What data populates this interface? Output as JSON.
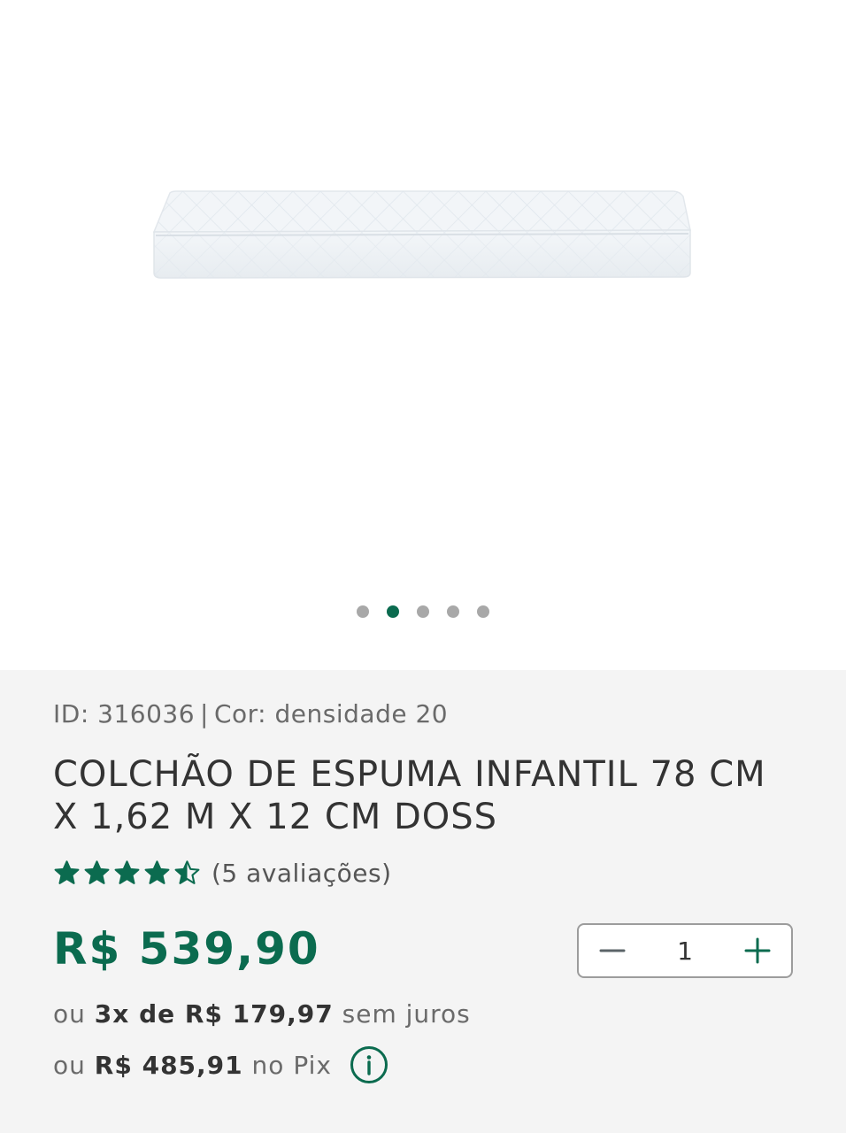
{
  "gallery": {
    "slide_count": 5,
    "active_index": 1,
    "image_icon": "mattress-image"
  },
  "product": {
    "id_label": "ID: 316036",
    "separator": "|",
    "color_label": "Cor: densidade 20",
    "title": "COLCHÃO DE ESPUMA INFANTIL 78 CM X 1,62 M X 12 CM DOSS",
    "rating_value": 4.5,
    "rating_max": 5,
    "rating_count_label": "(5 avaliações)",
    "price": "R$ 539,90",
    "installments_prefix": "ou",
    "installments_value": "3x de R$ 179,97",
    "installments_suffix": "sem juros",
    "pix_prefix": "ou",
    "pix_value": "R$ 485,91",
    "pix_suffix": "no Pix"
  },
  "quantity": {
    "value": "1",
    "minus_icon": "minus-icon",
    "plus_icon": "plus-icon"
  },
  "colors": {
    "brand_green": "#0b6b4f",
    "dot_inactive": "#a8a8a8"
  }
}
